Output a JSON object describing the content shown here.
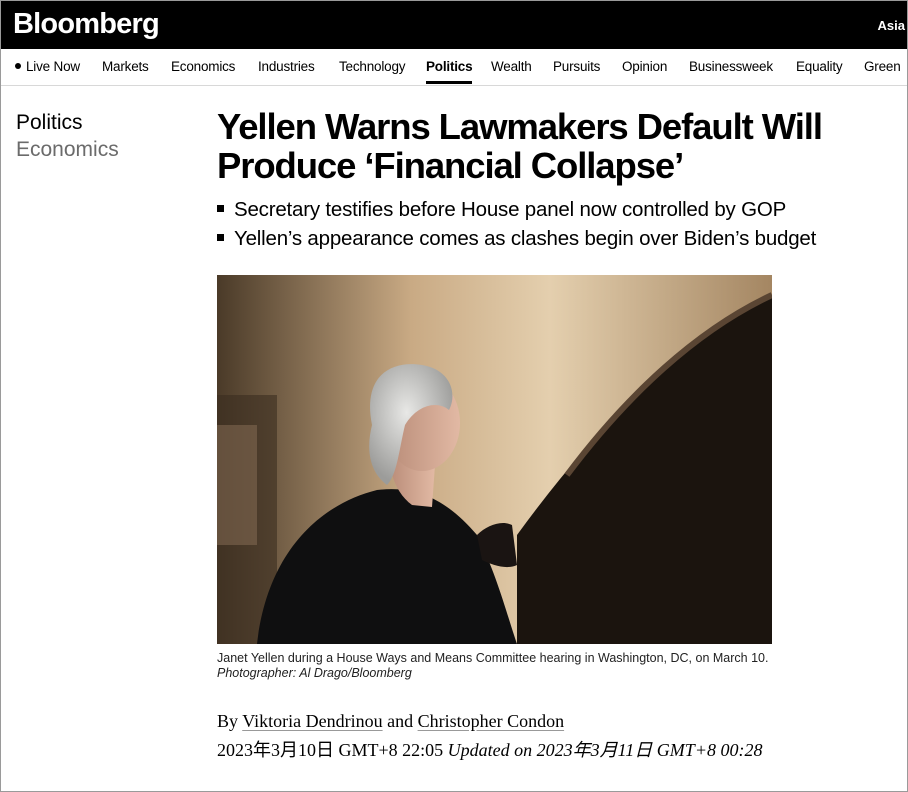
{
  "header": {
    "logo": "Bloomberg",
    "region": "Asia"
  },
  "nav": {
    "items": [
      {
        "label": "Live Now",
        "live": true
      },
      {
        "label": "Markets"
      },
      {
        "label": "Economics"
      },
      {
        "label": "Industries"
      },
      {
        "label": "Technology"
      },
      {
        "label": "Politics",
        "active": true
      },
      {
        "label": "Wealth"
      },
      {
        "label": "Pursuits"
      },
      {
        "label": "Opinion"
      },
      {
        "label": "Businessweek"
      },
      {
        "label": "Equality"
      },
      {
        "label": "Green"
      }
    ]
  },
  "sidebar": {
    "primary": "Politics",
    "secondary": "Economics"
  },
  "article": {
    "headline": "Yellen Warns Lawmakers Default Will Produce ‘Financial Collapse’",
    "bullets": [
      "Secretary testifies before House panel now controlled by GOP",
      "Yellen’s appearance comes as clashes begin over Biden’s budget"
    ],
    "caption": "Janet Yellen during a House Ways and Means Committee hearing in Washington, DC, on March 10.",
    "credit": "Photographer: Al Drago/Bloomberg",
    "byline_prefix": "By",
    "author1": "Viktoria Dendrinou",
    "byline_and": "and",
    "author2": "Christopher Condon",
    "published": "2023年3月10日 GMT+8 22:05",
    "updated": "Updated on 2023年3月11日 GMT+8 00:28"
  },
  "colors": {
    "header_bg": "#000000",
    "secondary_text": "#6b6b6b"
  }
}
